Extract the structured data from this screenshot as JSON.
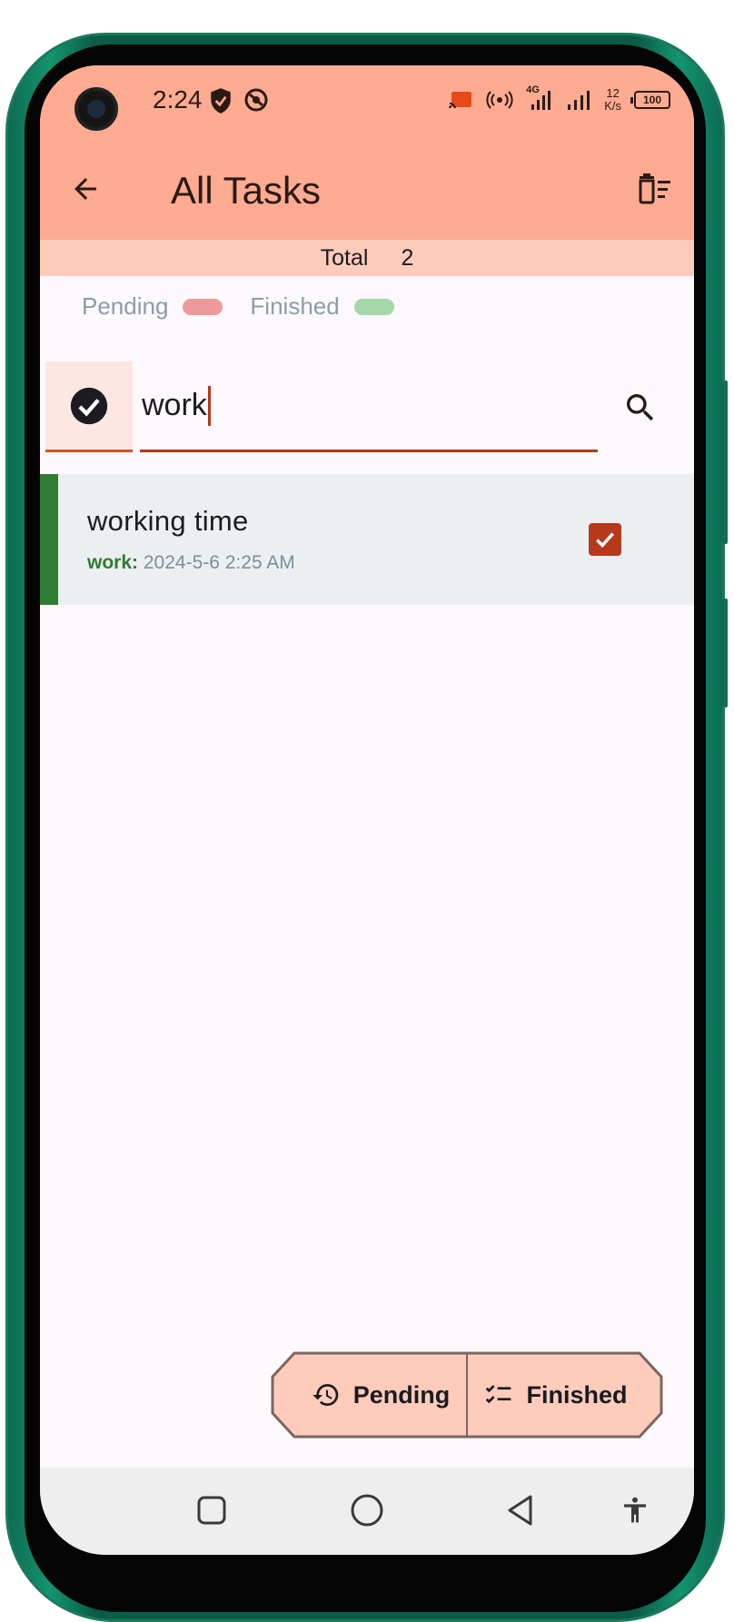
{
  "status_bar": {
    "time": "2:24",
    "network_label": "4G",
    "speed_value": "12",
    "speed_unit": "K/s",
    "battery": "100"
  },
  "app_bar": {
    "title": "All Tasks",
    "background_color": "#ffab91"
  },
  "summary": {
    "total_label": "Total",
    "total_count": "2"
  },
  "legend": [
    {
      "label": "Pending",
      "color": "#ef9a9a"
    },
    {
      "label": "Finished",
      "color": "#a5d6a7"
    }
  ],
  "search": {
    "value": "work"
  },
  "tasks": [
    {
      "title": "working time",
      "category": "work:",
      "datetime": "2024-5-6 2:25 AM",
      "completed": true,
      "accent_color": "#2e7d32"
    }
  ],
  "segmented": {
    "pending_label": "Pending",
    "finished_label": "Finished"
  },
  "colors": {
    "accent": "#b5391a",
    "segment_fill": "#ffccbc"
  }
}
